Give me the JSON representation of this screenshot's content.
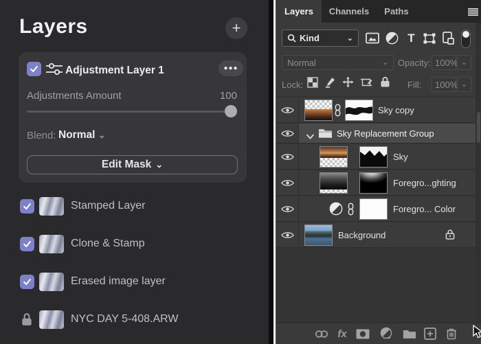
{
  "left_panel": {
    "title": "Layers",
    "add_icon": "+",
    "card": {
      "layer_name": "Adjustment Layer 1",
      "more_icon": "●●●",
      "amount_label": "Adjustments Amount",
      "amount_value": "100",
      "blend_label": "Blend:",
      "blend_value": "Normal",
      "chevron": "⌄",
      "edit_mask_label": "Edit Mask"
    },
    "layers": [
      {
        "name": "Stamped Layer",
        "control": "checkbox"
      },
      {
        "name": "Clone & Stamp",
        "control": "checkbox"
      },
      {
        "name": "Erased image layer",
        "control": "checkbox"
      },
      {
        "name": "NYC DAY 5-408.ARW",
        "control": "lock"
      }
    ],
    "colors": {
      "accent_checkbox": "#7d81c9",
      "panel_bg": "#2a2a2c",
      "card_bg": "#37373a"
    }
  },
  "right_panel": {
    "tabs": [
      {
        "label": "Layers",
        "active": true
      },
      {
        "label": "Channels",
        "active": false
      },
      {
        "label": "Paths",
        "active": false
      }
    ],
    "filter_row": {
      "kind_label": "Kind",
      "chevron": "⌄",
      "icons": [
        "pixel-layers-filter",
        "adjustment-layers-filter",
        "type-layers-filter",
        "shape-layers-filter",
        "smart-object-filter",
        "filter-toggle"
      ],
      "type_glyph": "T"
    },
    "blend_row": {
      "blend_value": "Normal",
      "opacity_label": "Opacity:",
      "opacity_value": "100%",
      "chevron": "⌄"
    },
    "lock_row": {
      "label": "Lock:",
      "icons": [
        "lock-transparent-pixels",
        "lock-image-pixels",
        "lock-position",
        "lock-artboard",
        "lock-all"
      ],
      "fill_label": "Fill:",
      "fill_value": "100%",
      "chevron": "⌄"
    },
    "layers": [
      {
        "name": "Sky copy",
        "type": "image+mask",
        "selected": false
      },
      {
        "name": "Sky Replacement Group",
        "type": "group",
        "selected": true,
        "expanded": true
      },
      {
        "name": "Sky",
        "type": "image+mask",
        "selected": false
      },
      {
        "name": "Foregro...ghting",
        "type": "image+mask",
        "selected": false
      },
      {
        "name": "Foregro... Color",
        "type": "adjustment+mask",
        "selected": false
      },
      {
        "name": "Background",
        "type": "image",
        "locked": true,
        "selected": false
      }
    ],
    "footer": {
      "fx_label": "fx",
      "icons": [
        "link-layers-icon",
        "layer-effects-icon",
        "add-mask-icon",
        "new-adjustment-layer-icon",
        "new-group-icon",
        "new-layer-icon",
        "delete-layer-icon"
      ]
    },
    "colors": {
      "panel_bg": "#3a3a3a",
      "selected_row": "#4a4a4a",
      "tabbar_bg": "#262626"
    }
  }
}
